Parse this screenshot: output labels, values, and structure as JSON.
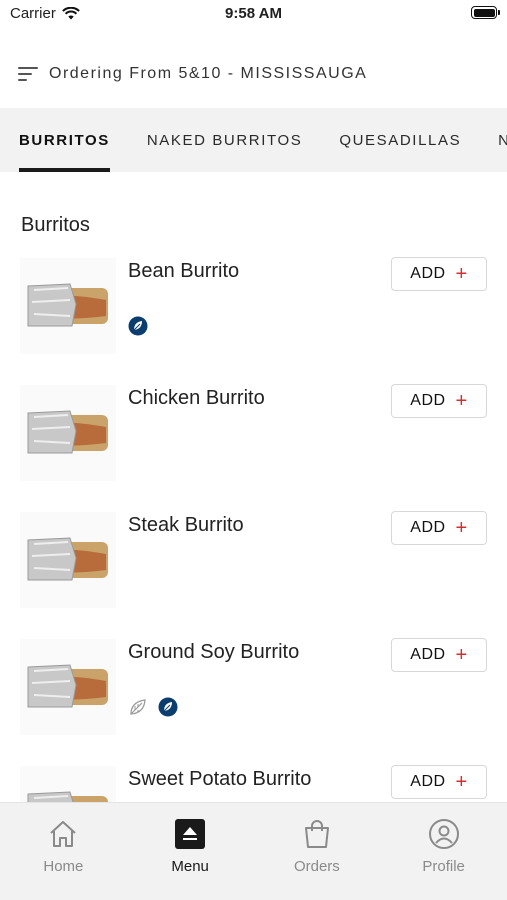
{
  "status_bar": {
    "carrier": "Carrier",
    "time": "9:58 AM"
  },
  "header": {
    "ordering_text": "Ordering From 5&10 - MISSISSAUGA",
    "menu_icon": "hamburger-menu-icon"
  },
  "tabs": [
    {
      "label": "BURRITOS",
      "active": true
    },
    {
      "label": "NAKED BURRITOS",
      "active": false
    },
    {
      "label": "QUESADILLAS",
      "active": false
    },
    {
      "label": "NACHOS",
      "active": false
    }
  ],
  "section": {
    "title": "Burritos"
  },
  "items": [
    {
      "name": "Bean Burrito",
      "add_label": "ADD",
      "add_symbol": "+",
      "tags": [
        "vegan-icon"
      ]
    },
    {
      "name": "Chicken Burrito",
      "add_label": "ADD",
      "add_symbol": "+",
      "tags": []
    },
    {
      "name": "Steak Burrito",
      "add_label": "ADD",
      "add_symbol": "+",
      "tags": []
    },
    {
      "name": "Ground Soy Burrito",
      "add_label": "ADD",
      "add_symbol": "+",
      "tags": [
        "vegetarian-leaf-icon",
        "vegan-icon"
      ]
    },
    {
      "name": "Sweet Potato Burrito",
      "add_label": "ADD",
      "add_symbol": "+",
      "tags": []
    }
  ],
  "bottom_nav": {
    "items": [
      {
        "label": "Home",
        "icon": "home-icon",
        "active": false
      },
      {
        "label": "Menu",
        "icon": "menu-tray-icon",
        "active": true
      },
      {
        "label": "Orders",
        "icon": "shopping-bag-icon",
        "active": false
      },
      {
        "label": "Profile",
        "icon": "profile-icon",
        "active": false
      }
    ]
  },
  "colors": {
    "accent_red": "#d32f2f",
    "vegan_badge": "#0b3d6e",
    "tab_bar_bg": "#f2f2f2",
    "active_text": "#1a1a1a",
    "inactive_nav": "#8a8a8a"
  }
}
